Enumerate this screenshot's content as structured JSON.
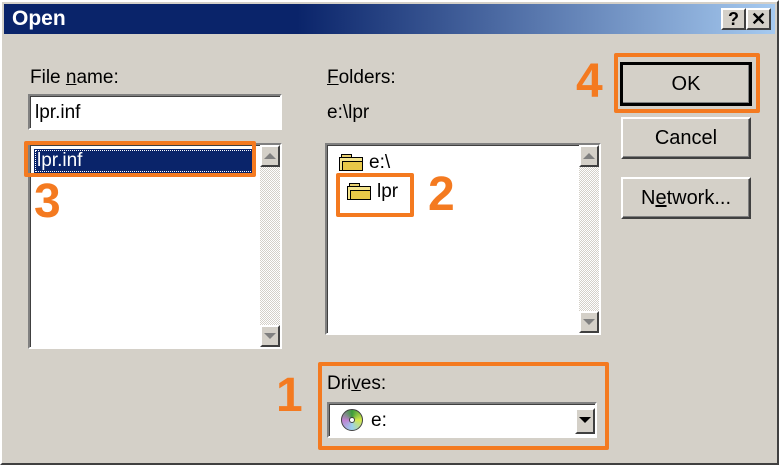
{
  "window": {
    "title": "Open",
    "help_label": "?",
    "close_label": "✕"
  },
  "filename": {
    "label_pre": "File ",
    "label_key": "n",
    "label_post": "ame:",
    "value": "lpr.inf",
    "files": [
      "lpr.inf"
    ]
  },
  "folders": {
    "label_key": "F",
    "label_post": "olders:",
    "path": "e:\\lpr",
    "items": [
      {
        "name": "e:\\",
        "icon": "open-folder-icon"
      },
      {
        "name": "lpr",
        "icon": "open-folder-icon"
      }
    ]
  },
  "drives": {
    "label_pre": "Dri",
    "label_key": "v",
    "label_post": "es:",
    "selected": "e:",
    "icon": "cd-drive-icon"
  },
  "buttons": {
    "ok": "OK",
    "cancel": "Cancel",
    "network_pre": "N",
    "network_key": "e",
    "network_post": "twork..."
  },
  "annotations": {
    "step1": "1",
    "step2": "2",
    "step3": "3",
    "step4": "4",
    "highlight_color": "#f47a20"
  }
}
